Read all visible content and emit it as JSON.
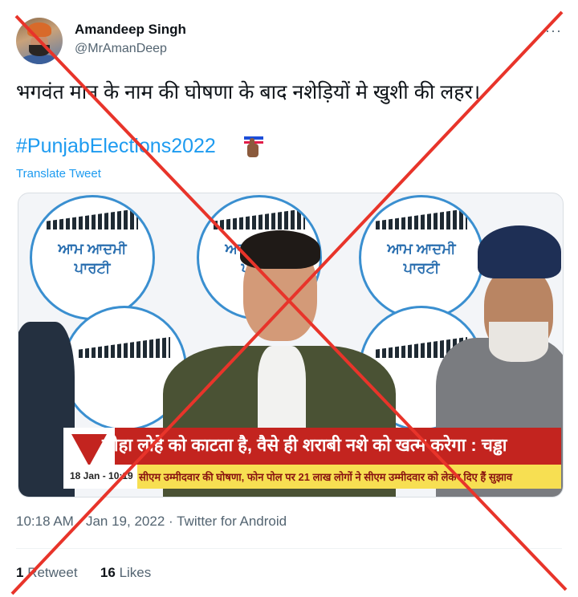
{
  "author": {
    "display_name": "Amandeep Singh",
    "handle": "@MrAmanDeep"
  },
  "more_icon": "···",
  "tweet": {
    "text": "भगवंत मान के नाम की घोषणा के बाद नशेड़ियों मे खुशी की लहर।",
    "hashtag": "#PunjabElections2022",
    "translate_label": "Translate Tweet"
  },
  "media": {
    "logo_text": [
      "ਆਮ ਆਦਮੀ",
      "ਪਾਰਟੀ"
    ],
    "banner_headline": "लोहा लोहे को काटता है, वैसे ही शराबी नशे को खत्म करेगा : चड्ढा",
    "ticker_time": "18 Jan - 10:19",
    "ticker_text": "सीएम उम्मीदवार की घोषणा, फोन पोल पर 21 लाख लोगों ने सीएम उम्मीदवार को लेकर दिए हैं सुझाव"
  },
  "meta": {
    "time": "10:18 AM",
    "separator": "·",
    "date": "Jan 19, 2022",
    "source": "Twitter for Android"
  },
  "stats": {
    "retweets": "1",
    "retweets_label": "Retweet",
    "likes": "16",
    "likes_label": "Likes"
  },
  "colors": {
    "accent": "#1d9bf0",
    "cross": "#e8342a",
    "banner_red": "#c3241f",
    "ticker_yellow": "#f7df52"
  }
}
